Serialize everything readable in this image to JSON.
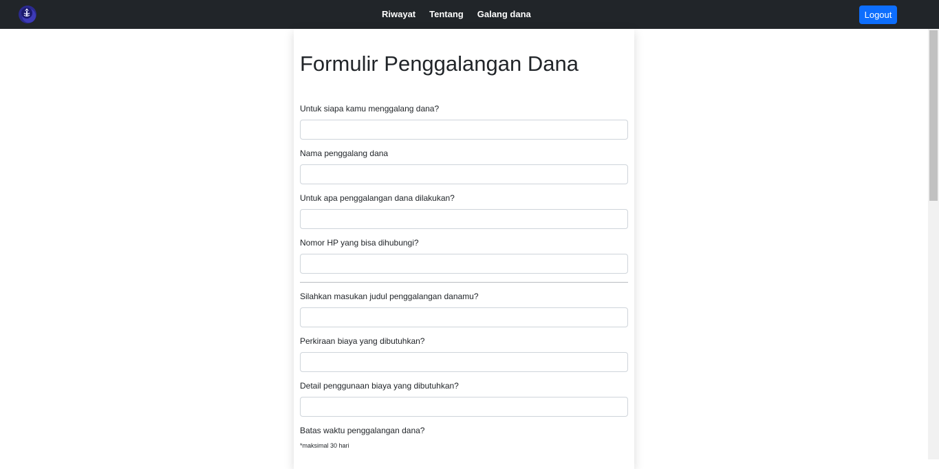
{
  "navbar": {
    "logo_icon": "org-logo-icon",
    "links": [
      "Riwayat",
      "Tentang",
      "Galang dana"
    ],
    "logout_label": "Logout",
    "colors": {
      "background": "#212529",
      "accent": "#0d6efd"
    }
  },
  "form": {
    "title": "Formulir Penggalangan Dana",
    "fields": [
      {
        "label": "Untuk siapa kamu menggalang dana?",
        "value": ""
      },
      {
        "label": "Nama penggalang dana",
        "value": ""
      },
      {
        "label": "Untuk apa penggalangan dana dilakukan?",
        "value": ""
      },
      {
        "label": "Nomor HP yang bisa dihubungi?",
        "value": ""
      },
      {
        "label": "Silahkan masukan judul penggalangan danamu?",
        "value": ""
      },
      {
        "label": "Perkiraan biaya yang dibutuhkan?",
        "value": ""
      },
      {
        "label": "Detail penggunaan biaya yang dibutuhkan?",
        "value": ""
      },
      {
        "label": "Batas waktu penggalangan dana?",
        "value": ""
      }
    ],
    "deadline_hint": "*maksimal 30 hari"
  }
}
